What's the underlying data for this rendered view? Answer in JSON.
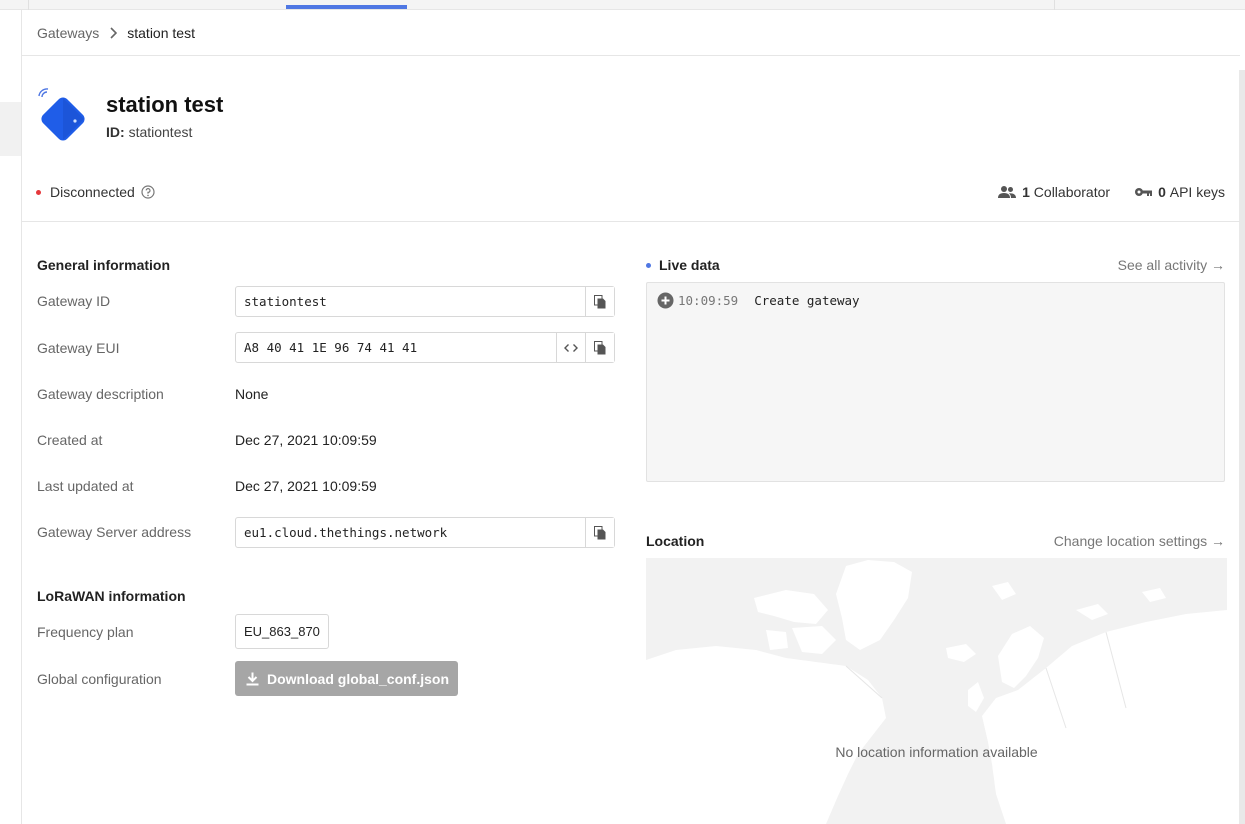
{
  "breadcrumb": {
    "parent": "Gateways",
    "current": "station test"
  },
  "gateway": {
    "name": "station test",
    "id_label": "ID:",
    "id_value": "stationtest",
    "status": "Disconnected",
    "collaborators": "1 Collaborator",
    "collaborators_count": "1",
    "collaborators_text": "Collaborator",
    "api_keys_count": "0",
    "api_keys_text": "API keys"
  },
  "general": {
    "title": "General information",
    "gateway_id_label": "Gateway ID",
    "gateway_id_value": "stationtest",
    "eui_label": "Gateway EUI",
    "eui_value": "A8 40 41 1E 96 74 41 41",
    "description_label": "Gateway description",
    "description_value": "None",
    "created_label": "Created at",
    "created_value": "Dec 27, 2021 10:09:59",
    "updated_label": "Last updated at",
    "updated_value": "Dec 27, 2021 10:09:59",
    "server_label": "Gateway Server address",
    "server_value": "eu1.cloud.thethings.network"
  },
  "lorawan": {
    "title": "LoRaWAN information",
    "freq_label": "Frequency plan",
    "freq_value": "EU_863_870",
    "global_label": "Global configuration",
    "download_label": "Download global_conf.json"
  },
  "live": {
    "title": "Live data",
    "see_all": "See all activity →",
    "events": [
      {
        "time": "10:09:59",
        "name": "Create gateway"
      }
    ]
  },
  "location": {
    "title": "Location",
    "change": "Change location settings →",
    "empty": "No location information available"
  },
  "colors": {
    "accent": "#4f77e3",
    "disconnected": "#e5383b",
    "button_disabled": "#a6a6a6",
    "gateway_icon": "#1f5de8"
  }
}
